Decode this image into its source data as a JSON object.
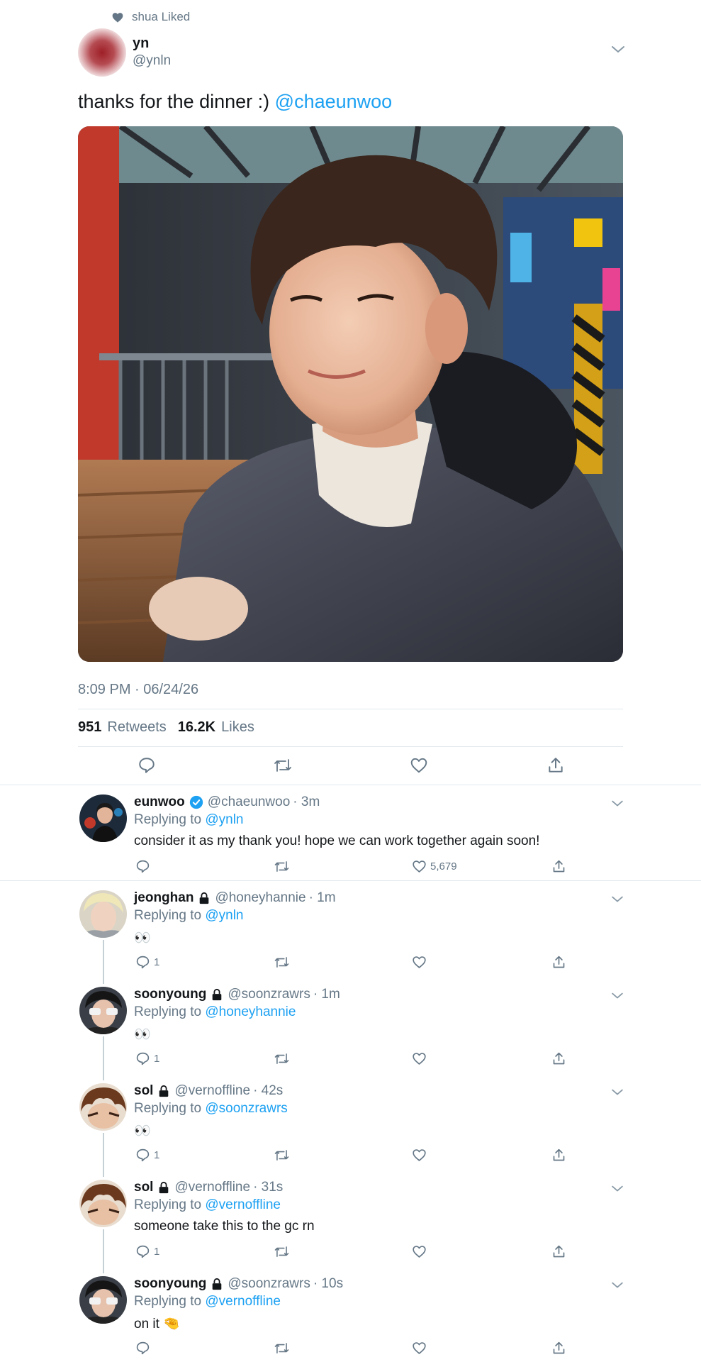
{
  "social_context": {
    "text": "shua Liked",
    "icon": "heart-icon"
  },
  "main_tweet": {
    "name": "yn",
    "handle": "@ynln",
    "text": "thanks for the dinner :) ",
    "mention": "@chaeunwoo",
    "timestamp": "8:09 PM · 06/24/26",
    "retweets_count": "951",
    "retweets_label": "Retweets",
    "likes_count": "16.2K",
    "likes_label": "Likes"
  },
  "replies": [
    {
      "name": "eunwoo",
      "verified": true,
      "locked": false,
      "handle": "@chaeunwoo",
      "time": "· 3m",
      "replying_prefix": "Replying to",
      "replying_to": "@ynln",
      "text": "consider it as my thank you! hope we can work together again soon!",
      "reply_count": "",
      "like_count": "5,679"
    },
    {
      "name": "jeonghan",
      "verified": false,
      "locked": true,
      "handle": "@honeyhannie",
      "time": "· 1m",
      "replying_prefix": "Replying to",
      "replying_to": "@ynln",
      "text": "👀",
      "reply_count": "1",
      "like_count": ""
    },
    {
      "name": "soonyoung",
      "verified": false,
      "locked": true,
      "handle": "@soonzrawrs",
      "time": "· 1m",
      "replying_prefix": "Replying to",
      "replying_to": "@honeyhannie",
      "text": "👀",
      "reply_count": "1",
      "like_count": ""
    },
    {
      "name": "sol",
      "verified": false,
      "locked": true,
      "handle": "@vernoffline",
      "time": "· 42s",
      "replying_prefix": "Replying to",
      "replying_to": "@soonzrawrs",
      "text": "👀",
      "reply_count": "1",
      "like_count": ""
    },
    {
      "name": "sol",
      "verified": false,
      "locked": true,
      "handle": "@vernoffline",
      "time": "· 31s",
      "replying_prefix": "Replying to",
      "replying_to": "@vernoffline",
      "text": "someone take this to the gc rn",
      "reply_count": "1",
      "like_count": ""
    },
    {
      "name": "soonyoung",
      "verified": false,
      "locked": true,
      "handle": "@soonzrawrs",
      "time": "· 10s",
      "replying_prefix": "Replying to",
      "replying_to": "@vernoffline",
      "text": "on it 🤏",
      "reply_count": "",
      "like_count": ""
    }
  ],
  "colors": {
    "accent": "#1da1f2",
    "muted": "#657786",
    "text": "#14171a",
    "divider": "#e1e8ed"
  }
}
